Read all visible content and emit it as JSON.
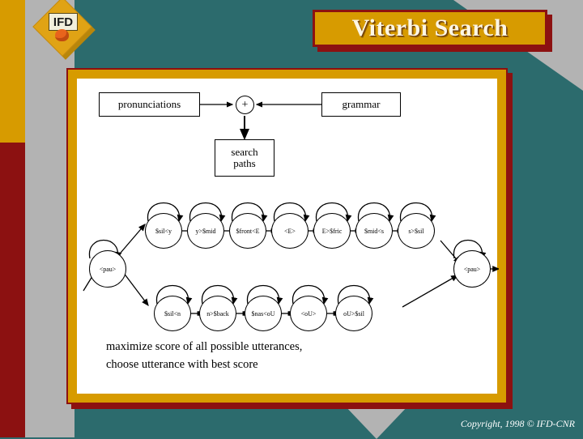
{
  "slide": {
    "title": "Viterbi Search",
    "copyright": "Copyright, 1998 © IFD-CNR",
    "logo_text": "IFD",
    "colors": {
      "background_teal": "#2c6b6d",
      "accent_gold": "#d79b00",
      "accent_dark_red": "#8c1111",
      "gray_triangle": "#b3b3b3",
      "title_text": "#fdf6e3",
      "content_background": "#ffffff"
    }
  },
  "diagram": {
    "top_blocks": {
      "left_box": "pronunciations",
      "combine_operator": "+",
      "right_box": "grammar",
      "output_box_line1": "search",
      "output_box_line2": "paths"
    },
    "entry_node": "<pau>",
    "exit_node": "<pau>",
    "top_chain": [
      "$sil<y",
      "y>$mid",
      "$front<E",
      "<E>",
      "E>$fric",
      "$mid<s",
      "s>$sil"
    ],
    "bottom_chain": [
      "$sil<n",
      "n>$back",
      "$nas<oU",
      "<oU>",
      "oU>$sil"
    ],
    "caption_line1": "maximize score of all possible utterances,",
    "caption_line2": "choose utterance with best score"
  }
}
